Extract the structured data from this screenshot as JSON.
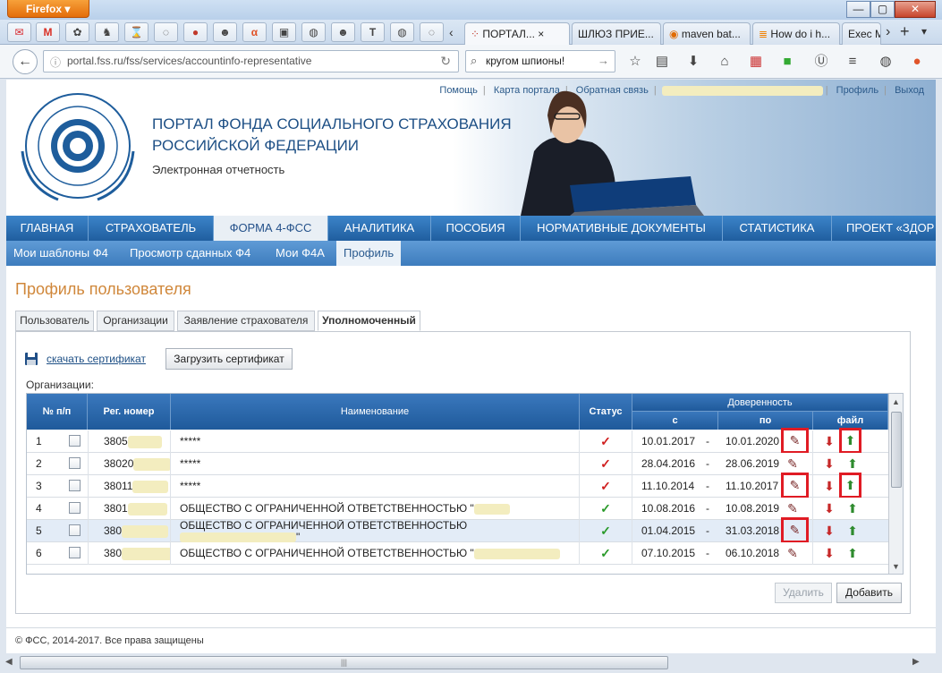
{
  "browser": {
    "app_label": "Firefox",
    "window_buttons": [
      "—",
      "▢",
      "✕"
    ],
    "tabs": [
      {
        "label": "ПОРТАЛ...",
        "active": true
      },
      {
        "label": "ШЛЮЗ ПРИЕ..."
      },
      {
        "label": "maven bat..."
      },
      {
        "label": "How do i h..."
      },
      {
        "label": "Exec M"
      }
    ],
    "url": "portal.fss.ru/fss/services/accountinfo-representative",
    "search_value": "кругом шпионы!"
  },
  "header": {
    "links": [
      "Помощь",
      "Карта портала",
      "Обратная связь",
      "Профиль",
      "Выход"
    ],
    "title_line1": "ПОРТАЛ ФОНДА СОЦИАЛЬНОГО СТРАХОВАНИЯ",
    "title_line2": "РОССИЙСКОЙ ФЕДЕРАЦИИ",
    "subtitle": "Электронная отчетность"
  },
  "main_nav": [
    "ГЛАВНАЯ",
    "СТРАХОВАТЕЛЬ",
    "ФОРМА 4-ФСС",
    "АНАЛИТИКА",
    "ПОСОБИЯ",
    "НОРМАТИВНЫЕ ДОКУМЕНТЫ",
    "СТАТИСТИКА",
    "ПРОЕКТ «ЗДОР"
  ],
  "sub_nav": [
    "Мои шаблоны Ф4",
    "Просмотр сданных Ф4",
    "Мои Ф4А",
    "Профиль"
  ],
  "page_title": "Профиль пользователя",
  "profile_tabs": [
    "Пользователь",
    "Организации",
    "Заявление страхователя",
    "Уполномоченный"
  ],
  "download_cert": "скачать сертификат",
  "upload_cert": "Загрузить сертификат",
  "orgs_label": "Организации:",
  "table": {
    "headers": {
      "num": "№ п/п",
      "reg": "Рег. номер",
      "name": "Наименование",
      "status": "Статус",
      "proxy": "Доверенность",
      "from": "с",
      "to": "по",
      "file": "файл"
    },
    "rows": [
      {
        "num": "1",
        "reg": "3805",
        "name": "*****",
        "status_icon": "red-check",
        "from": "10.01.2017",
        "dash": "-",
        "to": "10.01.2020"
      },
      {
        "num": "2",
        "reg": "38020",
        "name": "*****",
        "status_icon": "red-check",
        "from": "28.04.2016",
        "dash": "-",
        "to": "28.06.2019"
      },
      {
        "num": "3",
        "reg": "38011",
        "name": "*****",
        "status_icon": "red-check",
        "from": "11.10.2014",
        "dash": "-",
        "to": "11.10.2017"
      },
      {
        "num": "4",
        "reg": "3801",
        "name": "ОБЩЕСТВО С ОГРАНИЧЕННОЙ ОТВЕТСТВЕННОСТЬЮ \"",
        "status_icon": "green-check",
        "from": "10.08.2016",
        "dash": "-",
        "to": "10.08.2019"
      },
      {
        "num": "5",
        "reg": "380",
        "name": "ОБЩЕСТВО С ОГРАНИЧЕННОЙ ОТВЕТСТВЕННОСТЬЮ",
        "name2": "\"",
        "status_icon": "green-check",
        "from": "01.04.2015",
        "dash": "-",
        "to": "31.03.2018"
      },
      {
        "num": "6",
        "reg": "380",
        "name": "ОБЩЕСТВО С ОГРАНИЧЕННОЙ ОТВЕТСТВЕННОСТЬЮ \"",
        "status_icon": "green-check",
        "from": "07.10.2015",
        "dash": "-",
        "to": "06.10.2018"
      }
    ]
  },
  "buttons": {
    "delete": "Удалить",
    "add": "Добавить"
  },
  "footer": "© ФСС, 2014-2017. Все права защищены",
  "colors": {
    "accent": "#205e9f",
    "title": "#d0873a",
    "red_highlight": "#e01b24",
    "check_red": "#d02020",
    "check_green": "#2a9a2a"
  }
}
